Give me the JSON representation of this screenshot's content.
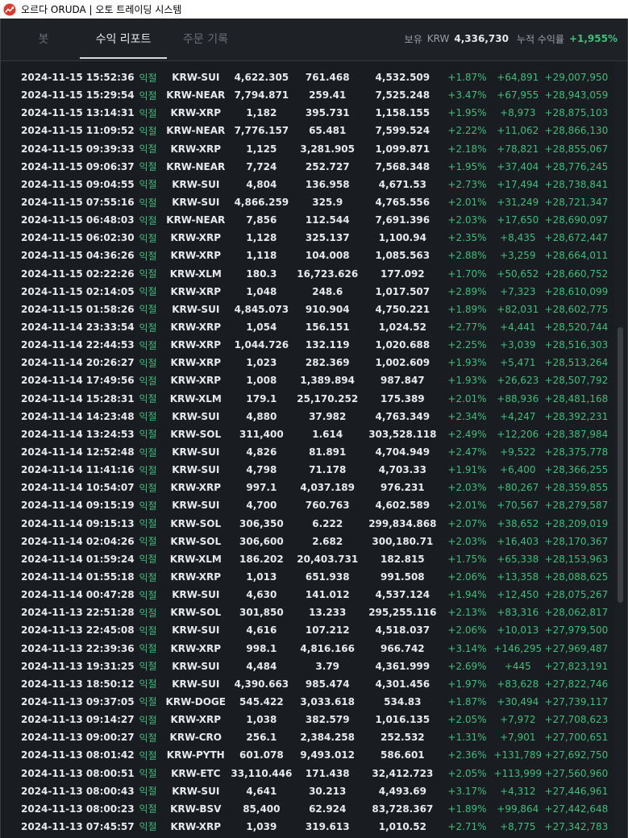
{
  "window": {
    "title": "오르다 ORUDA | 오토 트레이딩 시스템",
    "icon": "trend-chart-icon"
  },
  "tabs": [
    {
      "label": "봇",
      "active": false
    },
    {
      "label": "수익 리포트",
      "active": true
    },
    {
      "label": "주문 기록",
      "active": false
    }
  ],
  "summary": {
    "holding_label": "보유",
    "currency_label": "KRW",
    "holding_value": "4,336,730",
    "cumulative_label": "누적 수익률",
    "cumulative_value": "+1,955%"
  },
  "colors": {
    "positive": "#3fbf7a",
    "background": "#1b1e23"
  },
  "rows": [
    [
      "2024-11-15 15:52:36",
      "익절",
      "KRW-SUI",
      "4,622.305",
      "761.468",
      "4,532.509",
      "+1.87%",
      "+64,891",
      "+29,007,950"
    ],
    [
      "2024-11-15 15:29:54",
      "익절",
      "KRW-NEAR",
      "7,794.871",
      "259.41",
      "7,525.248",
      "+3.47%",
      "+67,955",
      "+28,943,059"
    ],
    [
      "2024-11-15 13:14:31",
      "익절",
      "KRW-XRP",
      "1,182",
      "395.731",
      "1,158.155",
      "+1.95%",
      "+8,973",
      "+28,875,103"
    ],
    [
      "2024-11-15 11:09:52",
      "익절",
      "KRW-NEAR",
      "7,776.157",
      "65.481",
      "7,599.524",
      "+2.22%",
      "+11,062",
      "+28,866,130"
    ],
    [
      "2024-11-15 09:39:33",
      "익절",
      "KRW-XRP",
      "1,125",
      "3,281.905",
      "1,099.871",
      "+2.18%",
      "+78,821",
      "+28,855,067"
    ],
    [
      "2024-11-15 09:06:37",
      "익절",
      "KRW-NEAR",
      "7,724",
      "252.727",
      "7,568.348",
      "+1.95%",
      "+37,404",
      "+28,776,245"
    ],
    [
      "2024-11-15 09:04:55",
      "익절",
      "KRW-SUI",
      "4,804",
      "136.958",
      "4,671.53",
      "+2.73%",
      "+17,494",
      "+28,738,841"
    ],
    [
      "2024-11-15 07:55:16",
      "익절",
      "KRW-SUI",
      "4,866.259",
      "325.9",
      "4,765.556",
      "+2.01%",
      "+31,249",
      "+28,721,347"
    ],
    [
      "2024-11-15 06:48:03",
      "익절",
      "KRW-NEAR",
      "7,856",
      "112.544",
      "7,691.396",
      "+2.03%",
      "+17,650",
      "+28,690,097"
    ],
    [
      "2024-11-15 06:02:30",
      "익절",
      "KRW-XRP",
      "1,128",
      "325.137",
      "1,100.94",
      "+2.35%",
      "+8,435",
      "+28,672,447"
    ],
    [
      "2024-11-15 04:36:26",
      "익절",
      "KRW-XRP",
      "1,118",
      "104.008",
      "1,085.563",
      "+2.88%",
      "+3,259",
      "+28,664,011"
    ],
    [
      "2024-11-15 02:22:26",
      "익절",
      "KRW-XLM",
      "180.3",
      "16,723.626",
      "177.092",
      "+1.70%",
      "+50,652",
      "+28,660,752"
    ],
    [
      "2024-11-15 02:14:05",
      "익절",
      "KRW-XRP",
      "1,048",
      "248.6",
      "1,017.507",
      "+2.89%",
      "+7,323",
      "+28,610,099"
    ],
    [
      "2024-11-15 01:58:26",
      "익절",
      "KRW-SUI",
      "4,845.073",
      "910.904",
      "4,750.221",
      "+1.89%",
      "+82,031",
      "+28,602,775"
    ],
    [
      "2024-11-14 23:33:54",
      "익절",
      "KRW-XRP",
      "1,054",
      "156.151",
      "1,024.52",
      "+2.77%",
      "+4,441",
      "+28,520,744"
    ],
    [
      "2024-11-14 22:44:53",
      "익절",
      "KRW-XRP",
      "1,044.726",
      "132.119",
      "1,020.688",
      "+2.25%",
      "+3,039",
      "+28,516,303"
    ],
    [
      "2024-11-14 20:26:27",
      "익절",
      "KRW-XRP",
      "1,023",
      "282.369",
      "1,002.609",
      "+1.93%",
      "+5,471",
      "+28,513,264"
    ],
    [
      "2024-11-14 17:49:56",
      "익절",
      "KRW-XRP",
      "1,008",
      "1,389.894",
      "987.847",
      "+1.93%",
      "+26,623",
      "+28,507,792"
    ],
    [
      "2024-11-14 15:28:31",
      "익절",
      "KRW-XLM",
      "179.1",
      "25,170.252",
      "175.389",
      "+2.01%",
      "+88,936",
      "+28,481,168"
    ],
    [
      "2024-11-14 14:23:48",
      "익절",
      "KRW-SUI",
      "4,880",
      "37.982",
      "4,763.349",
      "+2.34%",
      "+4,247",
      "+28,392,231"
    ],
    [
      "2024-11-14 13:24:53",
      "익절",
      "KRW-SOL",
      "311,400",
      "1.614",
      "303,528.118",
      "+2.49%",
      "+12,206",
      "+28,387,984"
    ],
    [
      "2024-11-14 12:52:48",
      "익절",
      "KRW-SUI",
      "4,826",
      "81.891",
      "4,704.949",
      "+2.47%",
      "+9,522",
      "+28,375,778"
    ],
    [
      "2024-11-14 11:41:16",
      "익절",
      "KRW-SUI",
      "4,798",
      "71.178",
      "4,703.33",
      "+1.91%",
      "+6,400",
      "+28,366,255"
    ],
    [
      "2024-11-14 10:54:07",
      "익절",
      "KRW-XRP",
      "997.1",
      "4,037.189",
      "976.231",
      "+2.03%",
      "+80,267",
      "+28,359,855"
    ],
    [
      "2024-11-14 09:15:19",
      "익절",
      "KRW-SUI",
      "4,700",
      "760.763",
      "4,602.589",
      "+2.01%",
      "+70,567",
      "+28,279,587"
    ],
    [
      "2024-11-14 09:15:13",
      "익절",
      "KRW-SOL",
      "306,350",
      "6.222",
      "299,834.868",
      "+2.07%",
      "+38,652",
      "+28,209,019"
    ],
    [
      "2024-11-14 02:04:26",
      "익절",
      "KRW-SOL",
      "306,600",
      "2.682",
      "300,180.71",
      "+2.03%",
      "+16,403",
      "+28,170,367"
    ],
    [
      "2024-11-14 01:59:24",
      "익절",
      "KRW-XLM",
      "186.202",
      "20,403.731",
      "182.815",
      "+1.75%",
      "+65,338",
      "+28,153,963"
    ],
    [
      "2024-11-14 01:55:18",
      "익절",
      "KRW-XRP",
      "1,013",
      "651.938",
      "991.508",
      "+2.06%",
      "+13,358",
      "+28,088,625"
    ],
    [
      "2024-11-14 00:47:28",
      "익절",
      "KRW-SUI",
      "4,630",
      "141.012",
      "4,537.124",
      "+1.94%",
      "+12,450",
      "+28,075,267"
    ],
    [
      "2024-11-13 22:51:28",
      "익절",
      "KRW-SOL",
      "301,850",
      "13.233",
      "295,255.116",
      "+2.13%",
      "+83,316",
      "+28,062,817"
    ],
    [
      "2024-11-13 22:45:08",
      "익절",
      "KRW-SUI",
      "4,616",
      "107.212",
      "4,518.037",
      "+2.06%",
      "+10,013",
      "+27,979,500"
    ],
    [
      "2024-11-13 22:39:36",
      "익절",
      "KRW-XRP",
      "998.1",
      "4,816.166",
      "966.742",
      "+3.14%",
      "+146,295",
      "+27,969,487"
    ],
    [
      "2024-11-13 19:31:25",
      "익절",
      "KRW-SUI",
      "4,484",
      "3.79",
      "4,361.999",
      "+2.69%",
      "+445",
      "+27,823,191"
    ],
    [
      "2024-11-13 18:50:12",
      "익절",
      "KRW-SUI",
      "4,390.663",
      "985.474",
      "4,301.456",
      "+1.97%",
      "+83,628",
      "+27,822,746"
    ],
    [
      "2024-11-13 09:37:05",
      "익절",
      "KRW-DOGE",
      "545.422",
      "3,033.618",
      "534.83",
      "+1.87%",
      "+30,494",
      "+27,739,117"
    ],
    [
      "2024-11-13 09:14:27",
      "익절",
      "KRW-XRP",
      "1,038",
      "382.579",
      "1,016.135",
      "+2.05%",
      "+7,972",
      "+27,708,623"
    ],
    [
      "2024-11-13 09:00:27",
      "익절",
      "KRW-CRO",
      "256.1",
      "2,384.258",
      "252.532",
      "+1.31%",
      "+7,901",
      "+27,700,651"
    ],
    [
      "2024-11-13 08:01:42",
      "익절",
      "KRW-PYTH",
      "601.078",
      "9,493.012",
      "586.601",
      "+2.36%",
      "+131,789",
      "+27,692,750"
    ],
    [
      "2024-11-13 08:00:51",
      "익절",
      "KRW-ETC",
      "33,110.446",
      "171.438",
      "32,412.723",
      "+2.05%",
      "+113,999",
      "+27,560,960"
    ],
    [
      "2024-11-13 08:00:43",
      "익절",
      "KRW-SUI",
      "4,641",
      "30.213",
      "4,493.69",
      "+3.17%",
      "+4,312",
      "+27,446,961"
    ],
    [
      "2024-11-13 08:00:23",
      "익절",
      "KRW-BSV",
      "85,400",
      "62.924",
      "83,728.367",
      "+1.89%",
      "+99,864",
      "+27,442,648"
    ],
    [
      "2024-11-13 07:45:57",
      "익절",
      "KRW-XRP",
      "1,039",
      "319.613",
      "1,010.52",
      "+2.71%",
      "+8,775",
      "+27,342,783"
    ]
  ]
}
